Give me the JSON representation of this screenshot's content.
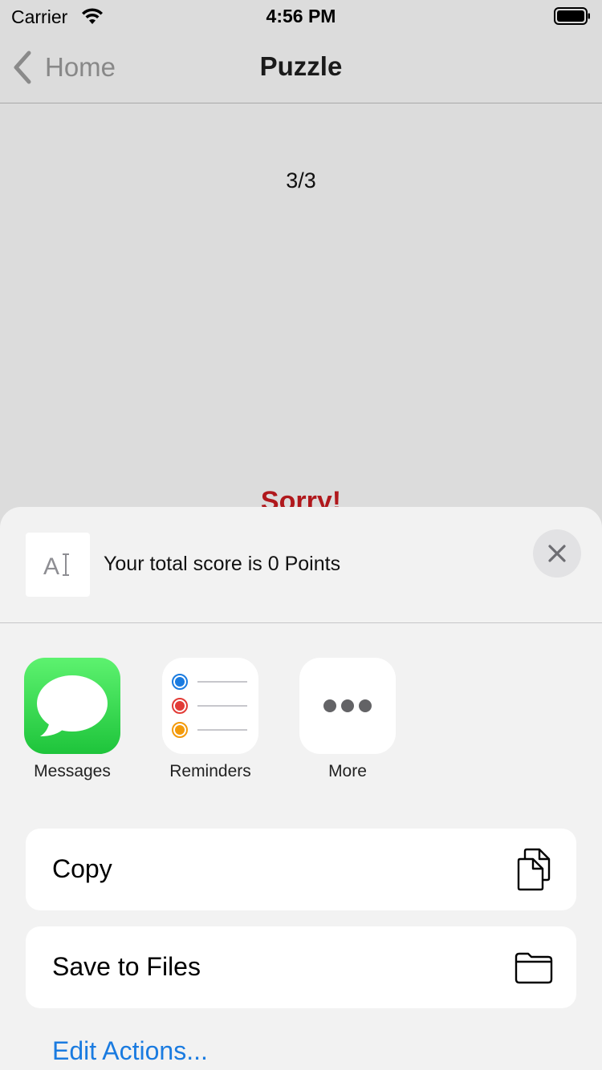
{
  "status_bar": {
    "carrier": "Carrier",
    "time": "4:56 PM",
    "icons": [
      "wifi-icon",
      "battery-icon"
    ]
  },
  "nav": {
    "back_label": "Home",
    "title": "Puzzle"
  },
  "content": {
    "progress": "3/3",
    "result_title": "Sorry!"
  },
  "share_sheet": {
    "preview_text": "Your total score is 0 Points",
    "apps": [
      {
        "label": "Messages",
        "icon": "messages-icon"
      },
      {
        "label": "Reminders",
        "icon": "reminders-icon"
      },
      {
        "label": "More",
        "icon": "more-icon"
      }
    ],
    "actions": [
      {
        "label": "Copy",
        "icon": "copy-icon"
      },
      {
        "label": "Save to Files",
        "icon": "folder-icon"
      }
    ],
    "edit_actions": "Edit Actions..."
  },
  "colors": {
    "background": "#dcdcdc",
    "sheet": "#f2f2f2",
    "accent_link": "#1a7be0",
    "result_red": "#b0181c",
    "messages_green": "#1ec43b"
  }
}
